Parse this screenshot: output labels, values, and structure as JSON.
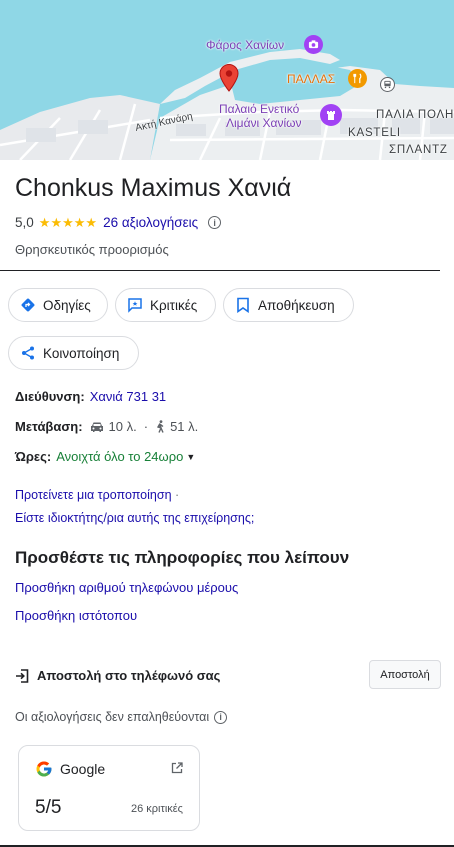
{
  "map": {
    "labels": {
      "lighthouse": "Φάρος Χανίων",
      "pallas": "ΠΑΛΛΑΣ",
      "harbor_line1": "Παλαιό Ενετικό",
      "harbor_line2": "Λιμάνι Χανίων",
      "street": "Ακτή Κανάρη",
      "old_town": "ΠΑΛΙΑ ΠΟΛΗ",
      "kasteli": "KASTELI",
      "splantzia": "ΣΠΛΑΝΤΖ"
    },
    "colors": {
      "water": "#8fd7e6",
      "land": "#eceff1",
      "pin": "#ea4335",
      "poi_purple": "#a142f4",
      "poi_orange": "#f29900"
    }
  },
  "place": {
    "title": "Chonkus Maximus Χανιά",
    "rating": "5,0",
    "stars": 5,
    "reviews_link": "26 αξιολογήσεις",
    "category": "Θρησκευτικός προορισμός"
  },
  "actions": {
    "directions": "Οδηγίες",
    "reviews": "Κριτικές",
    "save": "Αποθήκευση",
    "share": "Κοινοποίηση"
  },
  "details": {
    "address_label": "Διεύθυνση:",
    "address_value": "Χανιά 731 31",
    "transit_label": "Μετάβαση:",
    "drive_time": "10 λ.",
    "dot": "·",
    "walk_time": "51 λ.",
    "hours_label": "Ώρες:",
    "hours_value": "Ανοιχτά όλο το 24ωρο"
  },
  "edit_links": {
    "suggest_edit": "Προτείνετε μια τροποποίηση",
    "sep": "·",
    "own_business": "Είστε ιδιοκτήτης/ρια αυτής της επιχείρησης;"
  },
  "missing_info": {
    "title": "Προσθέστε τις πληροφορίες που λείπουν",
    "add_phone": "Προσθήκη αριθμού τηλεφώνου μέρους",
    "add_website": "Προσθήκη ιστότοπου"
  },
  "send_to_phone": {
    "label": "Αποστολή στο τηλέφωνό σας",
    "button": "Αποστολή"
  },
  "reviews_note": "Οι αξιολογήσεις δεν επαληθεύονται",
  "review_card": {
    "source": "Google",
    "score": "5/5",
    "count": "26 κριτικές"
  },
  "colors": {
    "link": "#1a0dab",
    "open_green": "#188038",
    "star": "#fbbc04",
    "directions_blue": "#1a73e8"
  }
}
